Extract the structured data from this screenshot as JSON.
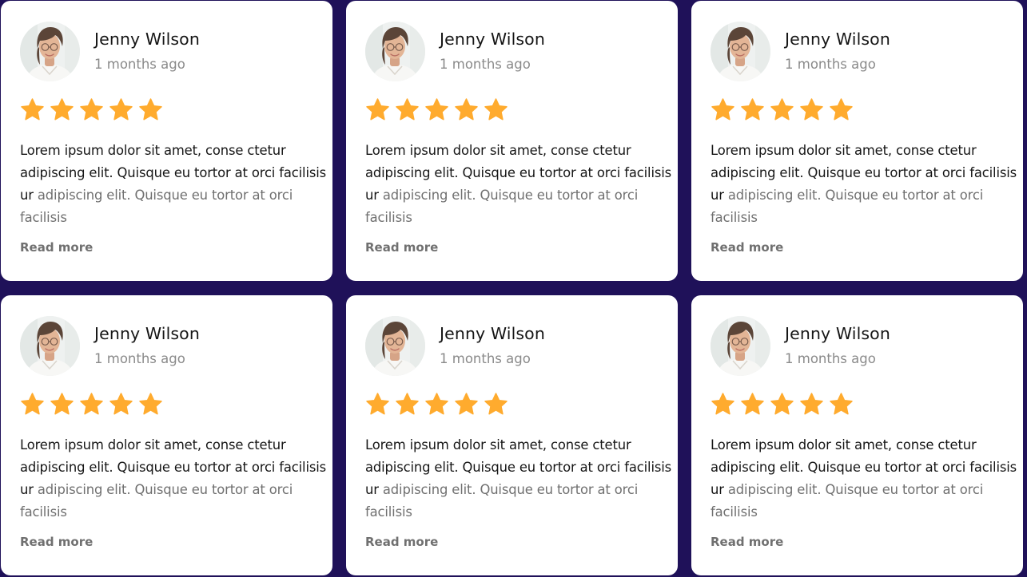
{
  "colors": {
    "background": "#1f1159",
    "card": "#ffffff",
    "star": "#ffab2e",
    "name_text": "#161616",
    "muted_text": "#707070"
  },
  "reviews": [
    {
      "name": "Jenny Wilson",
      "time": "1 months ago",
      "rating": 5,
      "body_strong": "Lorem ipsum dolor sit amet, conse ctetur adipiscing elit. Quisque eu tortor at orci facilisis ur",
      "body_rest": " adipiscing elit. Quisque eu tortor at orci facilisis",
      "read_more": "Read more",
      "avatar_icon": "user-avatar-photo"
    },
    {
      "name": "Jenny Wilson",
      "time": "1 months ago",
      "rating": 5,
      "body_strong": "Lorem ipsum dolor sit amet, conse ctetur adipiscing elit. Quisque eu tortor at orci facilisis ur",
      "body_rest": " adipiscing elit. Quisque eu tortor at orci facilisis",
      "read_more": "Read more",
      "avatar_icon": "user-avatar-photo"
    },
    {
      "name": "Jenny Wilson",
      "time": "1 months ago",
      "rating": 5,
      "body_strong": "Lorem ipsum dolor sit amet, conse ctetur adipiscing elit. Quisque eu tortor at orci facilisis ur",
      "body_rest": " adipiscing elit. Quisque eu tortor at orci facilisis",
      "read_more": "Read more",
      "avatar_icon": "user-avatar-photo"
    },
    {
      "name": "Jenny Wilson",
      "time": "1 months ago",
      "rating": 5,
      "body_strong": "Lorem ipsum dolor sit amet, conse ctetur adipiscing elit. Quisque eu tortor at orci facilisis ur",
      "body_rest": " adipiscing elit. Quisque eu tortor at orci facilisis",
      "read_more": "Read more",
      "avatar_icon": "user-avatar-photo"
    },
    {
      "name": "Jenny Wilson",
      "time": "1 months ago",
      "rating": 5,
      "body_strong": "Lorem ipsum dolor sit amet, conse ctetur adipiscing elit. Quisque eu tortor at orci facilisis ur",
      "body_rest": " adipiscing elit. Quisque eu tortor at orci facilisis",
      "read_more": "Read more",
      "avatar_icon": "user-avatar-photo"
    },
    {
      "name": "Jenny Wilson",
      "time": "1 months ago",
      "rating": 5,
      "body_strong": "Lorem ipsum dolor sit amet, conse ctetur adipiscing elit. Quisque eu tortor at orci facilisis ur",
      "body_rest": " adipiscing elit. Quisque eu tortor at orci facilisis",
      "read_more": "Read more",
      "avatar_icon": "user-avatar-photo"
    }
  ]
}
